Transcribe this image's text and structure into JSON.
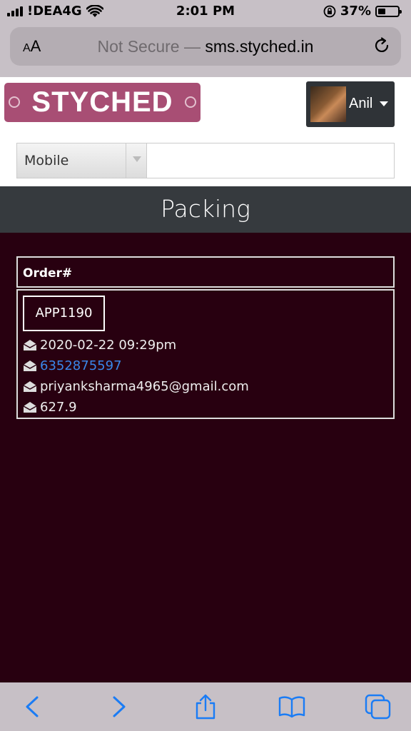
{
  "status": {
    "carrier": "!DEA4G",
    "time": "2:01 PM",
    "battery": "37%",
    "battery_level": 0.37
  },
  "browser": {
    "text_size_label": "AA",
    "insecure_label": "Not Secure —",
    "host": "sms.styched.in"
  },
  "header": {
    "logo_text": "STYCHED",
    "user_name": "Anil",
    "search": {
      "select_value": "Mobile",
      "input_value": "",
      "placeholder": ""
    }
  },
  "page": {
    "title": "Packing"
  },
  "table": {
    "column_header": "Order#",
    "rows": [
      {
        "order_id": "APP1190",
        "datetime": "2020-02-22 09:29pm",
        "phone": "6352875597",
        "email": "priyanksharma4965@gmail.com",
        "amount": "627.9"
      }
    ]
  },
  "colors": {
    "accent": "#a84e74",
    "page_bg": "#280010",
    "header_dark": "#363a3e",
    "link": "#3a86e8",
    "ios_blue": "#1a7cf5"
  },
  "icons": {
    "row_icon": "envelope-open-icon",
    "toolbar": [
      "back-icon",
      "forward-icon",
      "share-icon",
      "bookmarks-icon",
      "tabs-icon"
    ]
  }
}
